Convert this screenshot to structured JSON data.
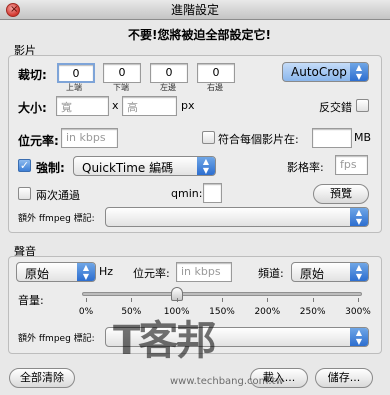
{
  "window": {
    "title": "進階設定"
  },
  "warning": "不要!您將被迫全部設定它!",
  "video": {
    "section_label": "影片",
    "crop_label": "裁切:",
    "crop_values": [
      "0",
      "0",
      "0",
      "0"
    ],
    "crop_captions": [
      "上端",
      "下端",
      "左邊",
      "右邊"
    ],
    "autocrop": "AutoCrop",
    "size_label": "大小:",
    "width_placeholder": "寬",
    "times": "x",
    "height_placeholder": "高",
    "px": "px",
    "deinterlace_label": "反交錯",
    "bitrate_label": "位元率:",
    "bitrate_placeholder": "in kbps",
    "fit_label": "符合每個影片在:",
    "mb": "MB",
    "force_label": "強制:",
    "codec_value": "QuickTime 編碼",
    "framerate_label": "影格率:",
    "fps_placeholder": "fps",
    "twopass_label": "兩次通過",
    "qmin_label": "qmin:",
    "preview_button": "預覽",
    "extra_label": "額外 ffmpeg 標記:"
  },
  "audio": {
    "section_label": "聲音",
    "samplerate_value": "原始",
    "hz": "Hz",
    "bitrate_label": "位元率:",
    "bitrate_placeholder": "in kbps",
    "channels_label": "頻道:",
    "channels_value": "原始",
    "volume_label": "音量:",
    "volume_percent": 100,
    "ticks": [
      "0%",
      "50%",
      "100%",
      "150%",
      "200%",
      "250%",
      "300%"
    ],
    "extra_label": "額外 ffmpeg 標記:"
  },
  "footer": {
    "clear_button": "全部清除",
    "load_button": "載入...",
    "save_button": "儲存..."
  },
  "watermark": {
    "logo": "T客邦",
    "url": "www.techbang.com.tw"
  }
}
